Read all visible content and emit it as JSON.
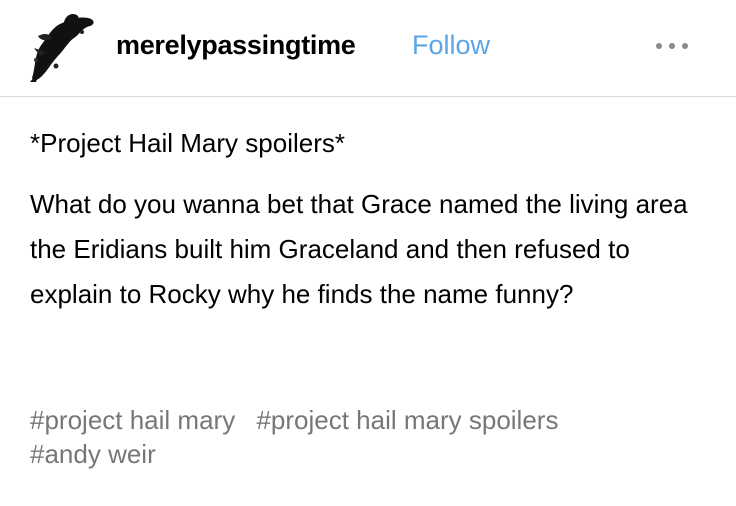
{
  "post": {
    "author": "merelypassingtime",
    "follow_label": "Follow",
    "spoiler_warning": "*Project Hail Mary spoilers*",
    "body_text": "What do you wanna bet that Grace named the living area the Eridians built him Graceland and then refused to explain to Rocky why he finds the name funny?",
    "tags": [
      "#project hail mary",
      "#project hail mary spoilers",
      "#andy weir"
    ]
  },
  "colors": {
    "follow": "#5aa5e6",
    "tags": "#777777",
    "divider": "#d9d9d9"
  },
  "icons": {
    "avatar": "black-ink-splatter-avatar",
    "more": "more-options-icon"
  }
}
